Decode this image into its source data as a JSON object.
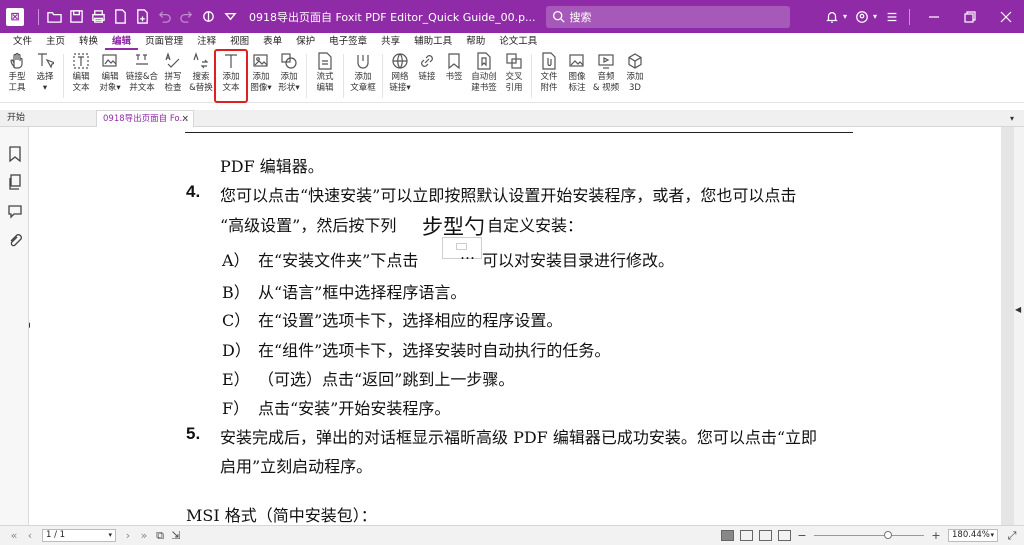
{
  "titlebar": {
    "logo": "foxit-logo",
    "title": "0918导出页面自 Foxit PDF Editor_Quick Guide_00.p...",
    "search_placeholder": "搜索",
    "accent": "#8f2ba6"
  },
  "menu": {
    "tabs": [
      "文件",
      "主页",
      "转换",
      "编辑",
      "页面管理",
      "注释",
      "视图",
      "表单",
      "保护",
      "电子签章",
      "共享",
      "辅助工具",
      "帮助",
      "论文工具"
    ],
    "active": "编辑"
  },
  "ribbon": {
    "buttons": [
      {
        "icon": "hand-icon",
        "label": "手型\n工具"
      },
      {
        "icon": "select-icon",
        "label": "选择\n▾"
      },
      {
        "icon": "edit-text-icon",
        "label": "编辑\n文本"
      },
      {
        "icon": "edit-object-icon",
        "label": "编辑\n对象▾"
      },
      {
        "icon": "link-join-icon",
        "label": "链接&合\n并文本"
      },
      {
        "icon": "spellcheck-icon",
        "label": "拼写\n检查"
      },
      {
        "icon": "search-replace-icon",
        "label": "搜索\n&替换"
      },
      {
        "icon": "add-text-icon",
        "label": "添加\n文本",
        "highlighted": true
      },
      {
        "icon": "add-image-icon",
        "label": "添加\n图像▾"
      },
      {
        "icon": "add-shape-icon",
        "label": "添加\n形状▾"
      },
      {
        "icon": "flow-edit-icon",
        "label": "流式\n编辑"
      },
      {
        "icon": "add-textbox-icon",
        "label": "添加\n文章框"
      },
      {
        "icon": "web-link-icon",
        "label": "网络\n链接▾"
      },
      {
        "icon": "link-icon",
        "label": "链接"
      },
      {
        "icon": "bookmark-icon",
        "label": "书签"
      },
      {
        "icon": "auto-bookmark-icon",
        "label": "自动创\n建书签"
      },
      {
        "icon": "cross-ref-icon",
        "label": "交叉\n引用"
      },
      {
        "icon": "attachment-icon",
        "label": "文件\n附件"
      },
      {
        "icon": "image-mark-icon",
        "label": "图像\n标注"
      },
      {
        "icon": "audio-video-icon",
        "label": "音频\n& 视频"
      },
      {
        "icon": "add-3d-icon",
        "label": "添加\n3D"
      }
    ]
  },
  "doctabs": {
    "home": "开始",
    "file": "0918导出页面自 Fo...",
    "close": "×"
  },
  "document": {
    "line_pdf": "PDF 编辑器。",
    "n4": "4.",
    "line4a": "您可以点击“快速安装”可以立即按照默认设置开始安装程序，或者，您也可以点击",
    "line4b_pre": "“高级设置”，然后按下列",
    "line4b_post": "自定义安装：",
    "float_text": "步型勺",
    "float_dots": "…",
    "itemA_label": "A）",
    "itemA_pre": "在“安装文件夹”下点击",
    "itemA_post": "可以对安装目录进行修改。",
    "itemB_label": "B）",
    "itemB": "从“语言”框中选择程序语言。",
    "itemC_label": "C）",
    "itemC": "在“设置”选项卡下，选择相应的程序设置。",
    "itemD_label": "D）",
    "itemD": "在“组件”选项卡下，选择安装时自动执行的任务。",
    "itemE_label": "E）",
    "itemE": "（可选）点击“返回”跳到上一步骤。",
    "itemF_label": "F）",
    "itemF": "点击“安装”开始安装程序。",
    "n5": "5.",
    "line5a": "安装完成后，弹出的对话框显示福昕高级 PDF 编辑器已成功安装。您可以点击“立即",
    "line5b": "启用”立刻启动程序。",
    "msi": "MSI 格式（简中安装包）："
  },
  "statusbar": {
    "page": "1 / 1",
    "zoom": "180.44%",
    "zoom_level": 0.6
  }
}
